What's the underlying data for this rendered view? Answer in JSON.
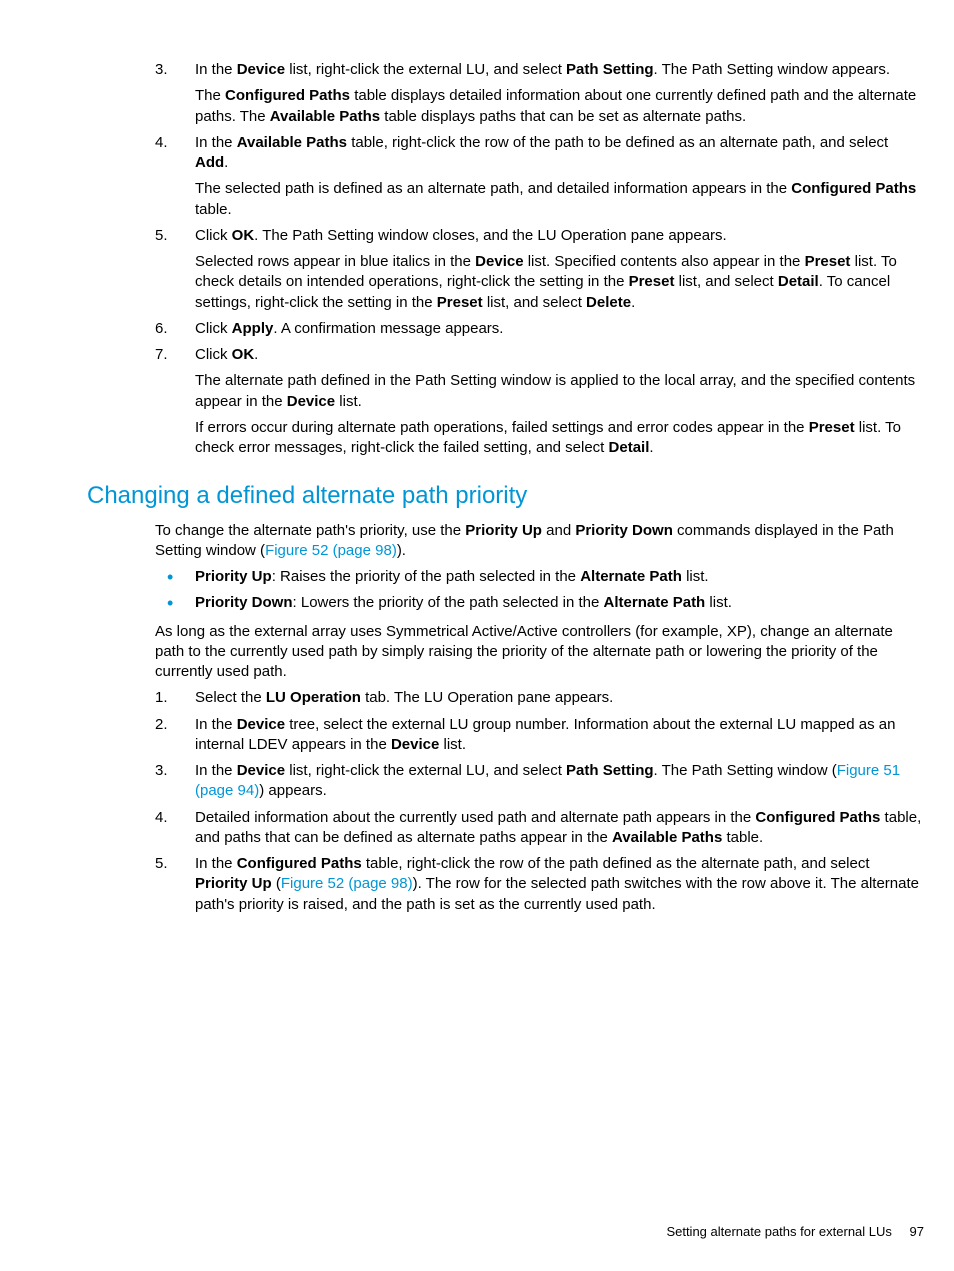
{
  "list1": {
    "items": [
      {
        "marker": "3.",
        "p1a": "In the ",
        "p1b": "Device",
        "p1c": " list, right-click the external LU, and select ",
        "p1d": "Path Setting",
        "p1e": ". The Path Setting window appears.",
        "p2a": "The ",
        "p2b": "Configured Paths",
        "p2c": " table displays detailed information about one currently defined path and the alternate paths. The ",
        "p2d": "Available Paths",
        "p2e": " table displays paths that can be set as alternate paths."
      },
      {
        "marker": "4.",
        "p1a": "In the ",
        "p1b": "Available Paths",
        "p1c": " table, right-click the row of the path to be defined as an alternate path, and select ",
        "p1d": "Add",
        "p1e": ".",
        "p2a": "The selected path is defined as an alternate path, and detailed information appears in the ",
        "p2b": "Configured Paths",
        "p2c": " table."
      },
      {
        "marker": "5.",
        "p1a": "Click ",
        "p1b": "OK",
        "p1c": ". The Path Setting window closes, and the LU Operation pane appears.",
        "p2a": "Selected rows appear in blue italics in the ",
        "p2b": "Device",
        "p2c": " list. Specified contents also appear in the ",
        "p2d": "Preset",
        "p2e": " list. To check details on intended operations, right-click the setting in the ",
        "p2f": "Preset",
        "p2g": " list, and select ",
        "p2h": "Detail",
        "p2i": ". To cancel settings, right-click the setting in the ",
        "p2j": "Preset",
        "p2k": " list, and select ",
        "p2l": "Delete",
        "p2m": "."
      },
      {
        "marker": "6.",
        "p1a": "Click ",
        "p1b": "Apply",
        "p1c": ". A confirmation message appears."
      },
      {
        "marker": "7.",
        "p1a": "Click ",
        "p1b": "OK",
        "p1c": ".",
        "p2a": "The alternate path defined in the Path Setting window is applied to the local array, and the specified contents appear in the ",
        "p2b": "Device",
        "p2c": " list.",
        "p3a": "If errors occur during alternate path operations, failed settings and error codes appear in the ",
        "p3b": "Preset",
        "p3c": " list. To check error messages, right-click the failed setting, and select ",
        "p3d": "Detail",
        "p3e": "."
      }
    ]
  },
  "section": {
    "title": "Changing a defined alternate path priority",
    "intro_a": "To change the alternate path's priority, use the ",
    "intro_b": "Priority Up",
    "intro_c": " and ",
    "intro_d": "Priority Down",
    "intro_e": " commands displayed in the Path Setting window (",
    "intro_link": "Figure 52 (page 98)",
    "intro_f": ").",
    "bullets": [
      {
        "b1": "Priority Up",
        "t1": ": Raises the priority of the path selected in the ",
        "b2": "Alternate Path",
        "t2": " list."
      },
      {
        "b1": "Priority Down",
        "t1": ": Lowers the priority of the path selected in the ",
        "b2": "Alternate Path",
        "t2": " list."
      }
    ],
    "para2": "As long as the external array uses Symmetrical Active/Active controllers (for example, XP), change an alternate path to the currently used path by simply raising the priority of the alternate path or lowering the priority of the currently used path.",
    "steps": [
      {
        "marker": "1.",
        "p1a": "Select the ",
        "p1b": "LU Operation",
        "p1c": " tab. The LU Operation pane appears."
      },
      {
        "marker": "2.",
        "p1a": "In the ",
        "p1b": "Device",
        "p1c": " tree, select the external LU group number. Information about the external LU mapped as an internal LDEV appears in the ",
        "p1d": "Device",
        "p1e": " list."
      },
      {
        "marker": "3.",
        "p1a": "In the ",
        "p1b": "Device",
        "p1c": " list, right-click the external LU, and select ",
        "p1d": "Path Setting",
        "p1e": ". The Path Setting window (",
        "link": "Figure 51 (page 94)",
        "p1f": ") appears."
      },
      {
        "marker": "4.",
        "p1a": "Detailed information about the currently used path and alternate path appears in the ",
        "p1b": "Configured Paths",
        "p1c": " table, and paths that can be defined as alternate paths appear in the ",
        "p1d": "Available Paths",
        "p1e": " table."
      },
      {
        "marker": "5.",
        "p1a": "In the ",
        "p1b": "Configured Paths",
        "p1c": " table, right-click the row of the path defined as the alternate path, and select ",
        "p1d": "Priority Up",
        "p1e": " (",
        "link": "Figure 52 (page 98)",
        "p1f": "). The row for the selected path switches with the row above it. The alternate path's priority is raised, and the path is set as the currently used path."
      }
    ]
  },
  "footer": {
    "text": "Setting alternate paths for external LUs",
    "page": "97"
  }
}
